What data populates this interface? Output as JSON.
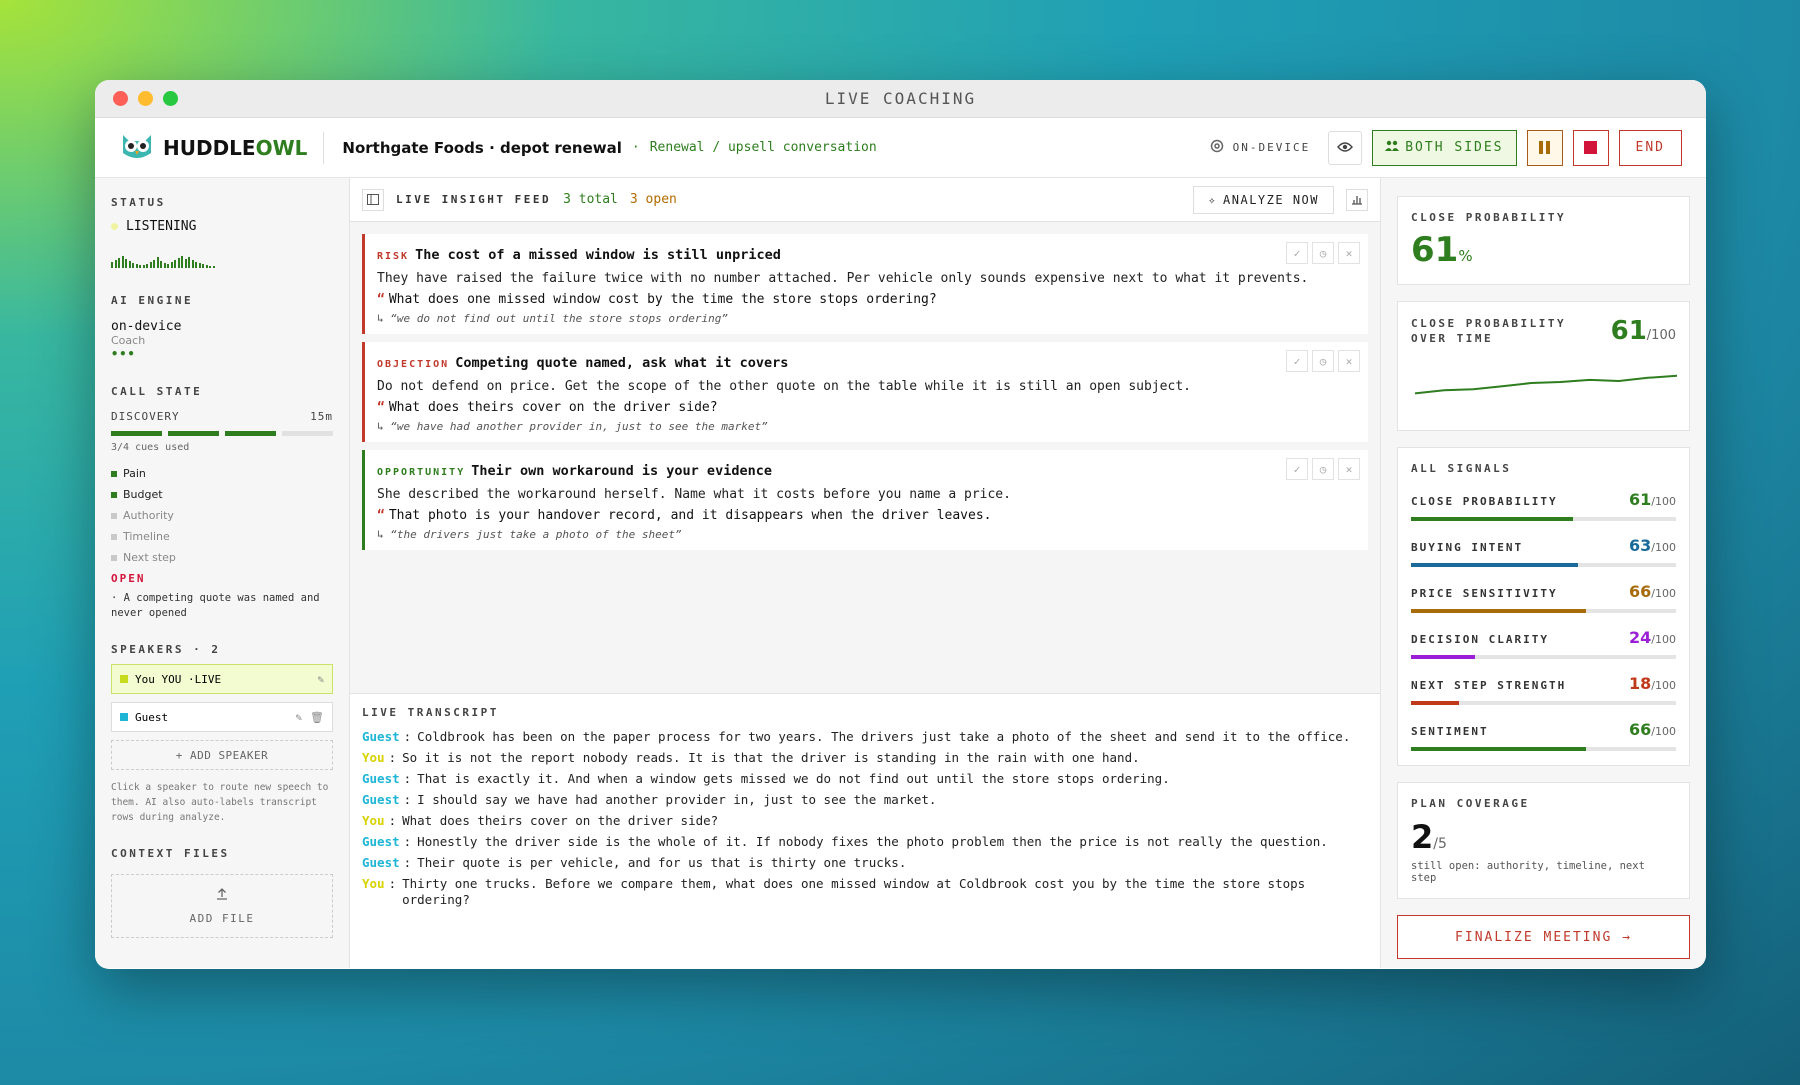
{
  "window": {
    "title": "LIVE COACHING"
  },
  "header": {
    "brand_prefix": "HUDDLE",
    "brand_suffix": "OWL",
    "deal": "Northgate Foods · depot renewal",
    "conversation_type": "Renewal / upsell conversation",
    "mode_label": "ON-DEVICE",
    "both_sides_label": "BOTH SIDES",
    "end_label": "END"
  },
  "sidebar": {
    "status_heading": "STATUS",
    "status_value": "LISTENING",
    "engine_heading": "AI ENGINE",
    "engine_value": "on-device",
    "engine_sub": "Coach",
    "engine_dots": "•••",
    "call_state_heading": "CALL STATE",
    "phase": "DISCOVERY",
    "phase_time": "15m",
    "cues_used": "3/4 cues used",
    "cues_done": 3,
    "cues_total": 4,
    "checklist": [
      {
        "label": "Pain",
        "done": true
      },
      {
        "label": "Budget",
        "done": true
      },
      {
        "label": "Authority",
        "done": false
      },
      {
        "label": "Timeline",
        "done": false
      },
      {
        "label": "Next step",
        "done": false
      }
    ],
    "open_heading": "OPEN",
    "open_item": "· A competing quote was named and never opened",
    "speakers_heading": "SPEAKERS · 2",
    "speakers": [
      {
        "label": "You YOU ·LIVE",
        "color": "#c8dc1e"
      },
      {
        "label": "Guest",
        "color": "#1fb6d6"
      }
    ],
    "add_speaker": "+ ADD SPEAKER",
    "hint": "Click a speaker to route new speech to them. AI also auto-labels transcript rows during analyze.",
    "context_heading": "CONTEXT FILES",
    "add_file": "ADD FILE"
  },
  "feed": {
    "title": "LIVE INSIGHT FEED",
    "total": "3 total",
    "open": "3 open",
    "analyze_label": "ANALYZE NOW",
    "cards": [
      {
        "tag": "RISK",
        "title": "The cost of a missed window is still unpriced",
        "body": "They have raised the failure twice with no number attached. Per vehicle only sounds expensive next to what it prevents.",
        "quote": "What does one missed window cost by the time the store stops ordering?",
        "source": "↳ “we do not find out until the store stops ordering”"
      },
      {
        "tag": "OBJECTION",
        "title": "Competing quote named, ask what it covers",
        "body": "Do not defend on price. Get the scope of the other quote on the table while it is still an open subject.",
        "quote": "What does theirs cover on the driver side?",
        "source": "↳ “we have had another provider in, just to see the market”"
      },
      {
        "tag": "OPPORTUNITY",
        "title": "Their own workaround is your evidence",
        "body": "She described the workaround herself. Name what it costs before you name a price.",
        "quote": "That photo is your handover record, and it disappears when the driver leaves.",
        "source": "↳ “the drivers just take a photo of the sheet”"
      }
    ]
  },
  "transcript": {
    "title": "LIVE TRANSCRIPT",
    "lines": [
      {
        "who": "Guest",
        "text": "Coldbrook has been on the paper process for two years. The drivers just take a photo of the sheet and send it to the office."
      },
      {
        "who": "You",
        "text": "So it is not the report nobody reads. It is that the driver is standing in the rain with one hand."
      },
      {
        "who": "Guest",
        "text": "That is exactly it. And when a window gets missed we do not find out until the store stops ordering."
      },
      {
        "who": "Guest",
        "text": "I should say we have had another provider in, just to see the market."
      },
      {
        "who": "You",
        "text": "What does theirs cover on the driver side?"
      },
      {
        "who": "Guest",
        "text": "Honestly the driver side is the whole of it. If nobody fixes the photo problem then the price is not really the question."
      },
      {
        "who": "Guest",
        "text": "Their quote is per vehicle, and for us that is thirty one trucks."
      },
      {
        "who": "You",
        "text": "Thirty one trucks. Before we compare them, what does one missed window at Coldbrook cost you by the time the store stops ordering?"
      }
    ]
  },
  "right": {
    "close_heading": "CLOSE PROBABILITY",
    "close_value": "61",
    "close_unit": "%",
    "overtime_heading": "CLOSE PROBABILITY OVER TIME",
    "overtime_value": "61",
    "overtime_unit": "/100",
    "trend": [
      44,
      47,
      48,
      51,
      54,
      55,
      57,
      56,
      59,
      61
    ],
    "signals_heading": "ALL SIGNALS",
    "signals": [
      {
        "label": "CLOSE PROBABILITY",
        "value": 61,
        "unit": "/100",
        "color": "#2e7d1e"
      },
      {
        "label": "BUYING INTENT",
        "value": 63,
        "unit": "/100",
        "color": "#1a6a9a"
      },
      {
        "label": "PRICE SENSITIVITY",
        "value": 66,
        "unit": "/100",
        "color": "#a86b0a"
      },
      {
        "label": "DECISION CLARITY",
        "value": 24,
        "unit": "/100",
        "color": "#9b1fd6"
      },
      {
        "label": "NEXT STEP STRENGTH",
        "value": 18,
        "unit": "/100",
        "color": "#c0391b"
      },
      {
        "label": "SENTIMENT",
        "value": 66,
        "unit": "/100",
        "color": "#2e7d1e"
      }
    ],
    "plan_heading": "PLAN COVERAGE",
    "plan_value": "2",
    "plan_unit": "/5",
    "plan_sub": "still open: authority, timeline, next step",
    "finalize_label": "FINALIZE MEETING →"
  }
}
